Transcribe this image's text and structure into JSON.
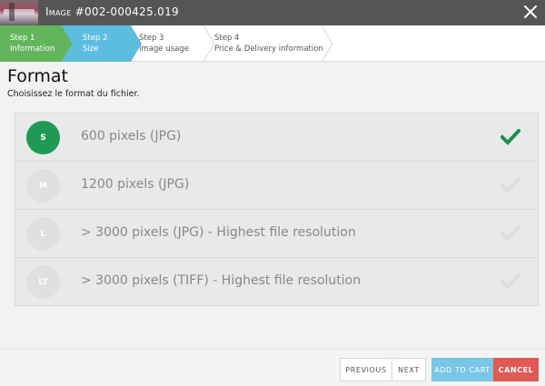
{
  "window": {
    "title": "Image #002-000425.019",
    "close_icon": "close-icon"
  },
  "steps": [
    {
      "num": "Step 1",
      "name": "Information",
      "state": "done",
      "color": "#62b55b"
    },
    {
      "num": "Step 2",
      "name": "Size",
      "state": "active",
      "color": "#5bbde0"
    },
    {
      "num": "Step 3",
      "name": "Image usage",
      "state": "pending"
    },
    {
      "num": "Step 4",
      "name": "Price & Delivery information",
      "state": "pending"
    }
  ],
  "main": {
    "heading": "Format",
    "subtitle": "Choisissez le format du fichier."
  },
  "options": [
    {
      "badge": "S",
      "label": "600 pixels (JPG)",
      "selected": true
    },
    {
      "badge": "M",
      "label": "1200 pixels (JPG)",
      "selected": false
    },
    {
      "badge": "L",
      "label": "> 3000 pixels (JPG) - Highest file resolution",
      "selected": false
    },
    {
      "badge": "LT",
      "label": "> 3000 pixels (TIFF) - Highest file resolution",
      "selected": false
    }
  ],
  "footer": {
    "previous": "PREVIOUS",
    "next": "NEXT",
    "add_to_cart": "ADD TO CART",
    "cancel": "CANCEL"
  },
  "colors": {
    "selected_badge": "#1f9a56",
    "check_selected": "#1f8f4e",
    "check_unselected": "#dcdcdc",
    "cart_button": "#79c6e6",
    "cancel_button": "#e05a54"
  }
}
